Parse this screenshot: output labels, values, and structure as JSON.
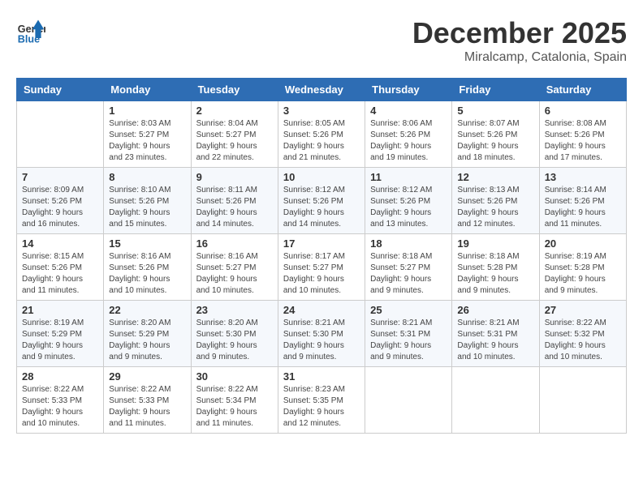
{
  "header": {
    "logo_general": "General",
    "logo_blue": "Blue",
    "month_title": "December 2025",
    "location": "Miralcamp, Catalonia, Spain"
  },
  "days_of_week": [
    "Sunday",
    "Monday",
    "Tuesday",
    "Wednesday",
    "Thursday",
    "Friday",
    "Saturday"
  ],
  "weeks": [
    [
      {
        "day": "",
        "sunrise": "",
        "sunset": "",
        "daylight": ""
      },
      {
        "day": "1",
        "sunrise": "Sunrise: 8:03 AM",
        "sunset": "Sunset: 5:27 PM",
        "daylight": "Daylight: 9 hours and 23 minutes."
      },
      {
        "day": "2",
        "sunrise": "Sunrise: 8:04 AM",
        "sunset": "Sunset: 5:27 PM",
        "daylight": "Daylight: 9 hours and 22 minutes."
      },
      {
        "day": "3",
        "sunrise": "Sunrise: 8:05 AM",
        "sunset": "Sunset: 5:26 PM",
        "daylight": "Daylight: 9 hours and 21 minutes."
      },
      {
        "day": "4",
        "sunrise": "Sunrise: 8:06 AM",
        "sunset": "Sunset: 5:26 PM",
        "daylight": "Daylight: 9 hours and 19 minutes."
      },
      {
        "day": "5",
        "sunrise": "Sunrise: 8:07 AM",
        "sunset": "Sunset: 5:26 PM",
        "daylight": "Daylight: 9 hours and 18 minutes."
      },
      {
        "day": "6",
        "sunrise": "Sunrise: 8:08 AM",
        "sunset": "Sunset: 5:26 PM",
        "daylight": "Daylight: 9 hours and 17 minutes."
      }
    ],
    [
      {
        "day": "7",
        "sunrise": "Sunrise: 8:09 AM",
        "sunset": "Sunset: 5:26 PM",
        "daylight": "Daylight: 9 hours and 16 minutes."
      },
      {
        "day": "8",
        "sunrise": "Sunrise: 8:10 AM",
        "sunset": "Sunset: 5:26 PM",
        "daylight": "Daylight: 9 hours and 15 minutes."
      },
      {
        "day": "9",
        "sunrise": "Sunrise: 8:11 AM",
        "sunset": "Sunset: 5:26 PM",
        "daylight": "Daylight: 9 hours and 14 minutes."
      },
      {
        "day": "10",
        "sunrise": "Sunrise: 8:12 AM",
        "sunset": "Sunset: 5:26 PM",
        "daylight": "Daylight: 9 hours and 14 minutes."
      },
      {
        "day": "11",
        "sunrise": "Sunrise: 8:12 AM",
        "sunset": "Sunset: 5:26 PM",
        "daylight": "Daylight: 9 hours and 13 minutes."
      },
      {
        "day": "12",
        "sunrise": "Sunrise: 8:13 AM",
        "sunset": "Sunset: 5:26 PM",
        "daylight": "Daylight: 9 hours and 12 minutes."
      },
      {
        "day": "13",
        "sunrise": "Sunrise: 8:14 AM",
        "sunset": "Sunset: 5:26 PM",
        "daylight": "Daylight: 9 hours and 11 minutes."
      }
    ],
    [
      {
        "day": "14",
        "sunrise": "Sunrise: 8:15 AM",
        "sunset": "Sunset: 5:26 PM",
        "daylight": "Daylight: 9 hours and 11 minutes."
      },
      {
        "day": "15",
        "sunrise": "Sunrise: 8:16 AM",
        "sunset": "Sunset: 5:26 PM",
        "daylight": "Daylight: 9 hours and 10 minutes."
      },
      {
        "day": "16",
        "sunrise": "Sunrise: 8:16 AM",
        "sunset": "Sunset: 5:27 PM",
        "daylight": "Daylight: 9 hours and 10 minutes."
      },
      {
        "day": "17",
        "sunrise": "Sunrise: 8:17 AM",
        "sunset": "Sunset: 5:27 PM",
        "daylight": "Daylight: 9 hours and 10 minutes."
      },
      {
        "day": "18",
        "sunrise": "Sunrise: 8:18 AM",
        "sunset": "Sunset: 5:27 PM",
        "daylight": "Daylight: 9 hours and 9 minutes."
      },
      {
        "day": "19",
        "sunrise": "Sunrise: 8:18 AM",
        "sunset": "Sunset: 5:28 PM",
        "daylight": "Daylight: 9 hours and 9 minutes."
      },
      {
        "day": "20",
        "sunrise": "Sunrise: 8:19 AM",
        "sunset": "Sunset: 5:28 PM",
        "daylight": "Daylight: 9 hours and 9 minutes."
      }
    ],
    [
      {
        "day": "21",
        "sunrise": "Sunrise: 8:19 AM",
        "sunset": "Sunset: 5:29 PM",
        "daylight": "Daylight: 9 hours and 9 minutes."
      },
      {
        "day": "22",
        "sunrise": "Sunrise: 8:20 AM",
        "sunset": "Sunset: 5:29 PM",
        "daylight": "Daylight: 9 hours and 9 minutes."
      },
      {
        "day": "23",
        "sunrise": "Sunrise: 8:20 AM",
        "sunset": "Sunset: 5:30 PM",
        "daylight": "Daylight: 9 hours and 9 minutes."
      },
      {
        "day": "24",
        "sunrise": "Sunrise: 8:21 AM",
        "sunset": "Sunset: 5:30 PM",
        "daylight": "Daylight: 9 hours and 9 minutes."
      },
      {
        "day": "25",
        "sunrise": "Sunrise: 8:21 AM",
        "sunset": "Sunset: 5:31 PM",
        "daylight": "Daylight: 9 hours and 9 minutes."
      },
      {
        "day": "26",
        "sunrise": "Sunrise: 8:21 AM",
        "sunset": "Sunset: 5:31 PM",
        "daylight": "Daylight: 9 hours and 10 minutes."
      },
      {
        "day": "27",
        "sunrise": "Sunrise: 8:22 AM",
        "sunset": "Sunset: 5:32 PM",
        "daylight": "Daylight: 9 hours and 10 minutes."
      }
    ],
    [
      {
        "day": "28",
        "sunrise": "Sunrise: 8:22 AM",
        "sunset": "Sunset: 5:33 PM",
        "daylight": "Daylight: 9 hours and 10 minutes."
      },
      {
        "day": "29",
        "sunrise": "Sunrise: 8:22 AM",
        "sunset": "Sunset: 5:33 PM",
        "daylight": "Daylight: 9 hours and 11 minutes."
      },
      {
        "day": "30",
        "sunrise": "Sunrise: 8:22 AM",
        "sunset": "Sunset: 5:34 PM",
        "daylight": "Daylight: 9 hours and 11 minutes."
      },
      {
        "day": "31",
        "sunrise": "Sunrise: 8:23 AM",
        "sunset": "Sunset: 5:35 PM",
        "daylight": "Daylight: 9 hours and 12 minutes."
      },
      {
        "day": "",
        "sunrise": "",
        "sunset": "",
        "daylight": ""
      },
      {
        "day": "",
        "sunrise": "",
        "sunset": "",
        "daylight": ""
      },
      {
        "day": "",
        "sunrise": "",
        "sunset": "",
        "daylight": ""
      }
    ]
  ]
}
